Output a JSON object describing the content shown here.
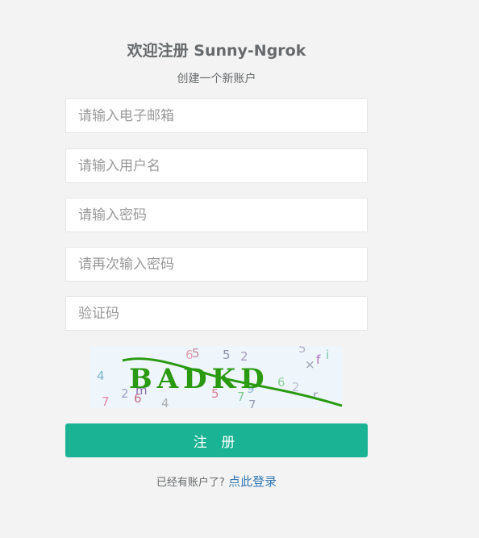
{
  "header": {
    "title": "欢迎注册 Sunny-Ngrok",
    "subtitle": "创建一个新账户"
  },
  "form": {
    "email_placeholder": "请输入电子邮箱",
    "username_placeholder": "请输入用户名",
    "password_placeholder": "请输入密码",
    "password_confirm_placeholder": "请再次输入密码",
    "captcha_placeholder": "验证码",
    "captcha_text": "BADKD",
    "submit_label": "注 册"
  },
  "footer": {
    "prompt": "已经有账户了?",
    "login_link": "点此登录"
  },
  "colors": {
    "background": "#f3f3f3",
    "primary": "#1ab394",
    "link": "#337ab7",
    "captcha_text": "#2a9a10"
  }
}
